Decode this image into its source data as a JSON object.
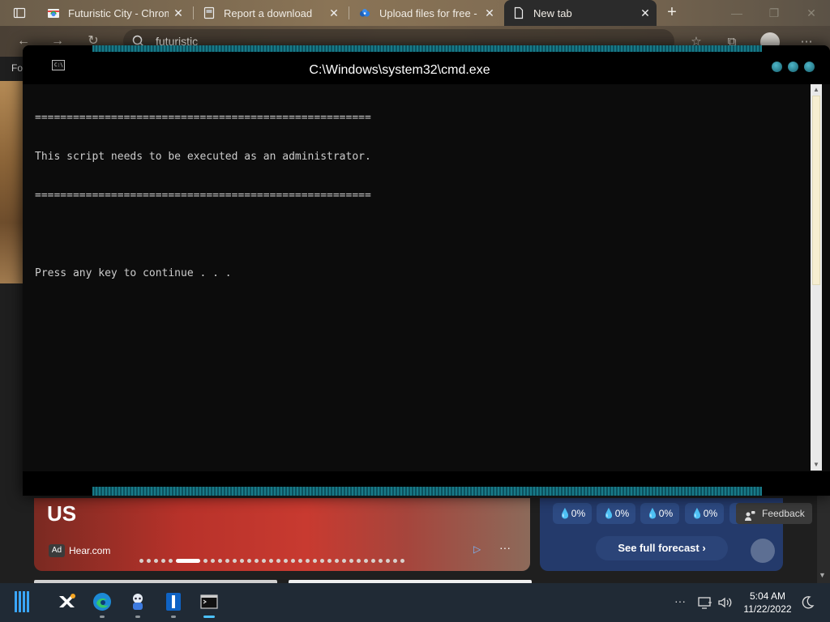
{
  "browser": {
    "tabs": [
      {
        "title": "Futuristic City - Chrome",
        "icon": "chrome-web-store-icon",
        "active": false
      },
      {
        "title": "Report a download",
        "icon": "document-icon",
        "active": false
      },
      {
        "title": "Upload files for free - O",
        "icon": "upload-cloud-icon",
        "active": false
      },
      {
        "title": "New tab",
        "icon": "page-icon",
        "active": true
      }
    ],
    "address": "futuristic",
    "favorites_label": "Fo"
  },
  "cmd_window": {
    "title": "C:\\Windows\\system32\\cmd.exe",
    "lines": [
      "=====================================================",
      "This script needs to be executed as an administrator.",
      "=====================================================",
      "",
      "Press any key to continue . . ."
    ]
  },
  "ad": {
    "headline": "US",
    "badge": "Ad",
    "source": "Hear.com",
    "more": "···"
  },
  "weather": {
    "precip": [
      " 💧0%",
      " 💧0%",
      " 💧0%",
      " 💧0%",
      " 💧0%"
    ],
    "precip_labels": [
      "0%",
      "0%",
      "0%",
      "0%",
      "0%"
    ],
    "forecast_button": "See full forecast ›"
  },
  "feedback_label": "Feedback",
  "taskbar": {
    "apps": [
      "xmind-icon",
      "edge-icon",
      "bot-icon",
      "tool-icon",
      "cmd-icon"
    ],
    "time": "5:04 AM",
    "date": "11/22/2022",
    "tray_more": "···"
  },
  "colors": {
    "cmd_text": "#cccccc",
    "cmd_bg": "#0c0c0c",
    "accent": "#4cc2ff",
    "weather_bg": "#243a6b"
  }
}
